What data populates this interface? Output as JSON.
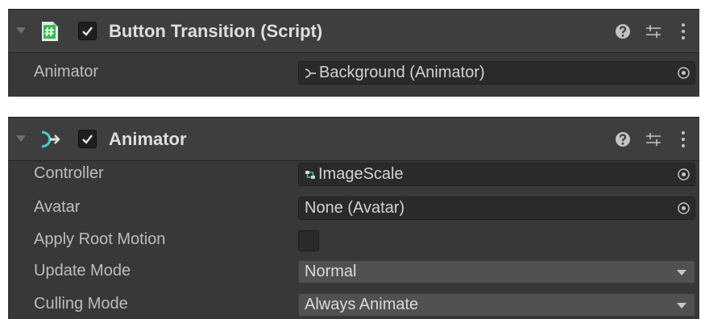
{
  "components": [
    {
      "title": "Button Transition (Script)",
      "icon": "script-icon",
      "enabled": true,
      "rows": [
        {
          "label": "Animator",
          "value": "Background (Animator)",
          "icon": "animator-small-icon"
        }
      ]
    },
    {
      "title": "Animator",
      "icon": "animator-icon",
      "enabled": true,
      "rows": [
        {
          "label": "Controller",
          "value": "ImageScale",
          "icon": "animator-controller-icon"
        },
        {
          "label": "Avatar",
          "value": "None (Avatar)"
        },
        {
          "label": "Apply Root Motion",
          "checked": false
        },
        {
          "label": "Update Mode",
          "value": "Normal"
        },
        {
          "label": "Culling Mode",
          "value": "Always Animate"
        }
      ]
    }
  ],
  "colors": {
    "background": "#383838",
    "header": "#3e3e3e",
    "field": "#2a2a2a",
    "dropdown": "#515151",
    "script_icon_green": "#2fbf45",
    "animator_icon_cyan": "#44d3c4"
  }
}
